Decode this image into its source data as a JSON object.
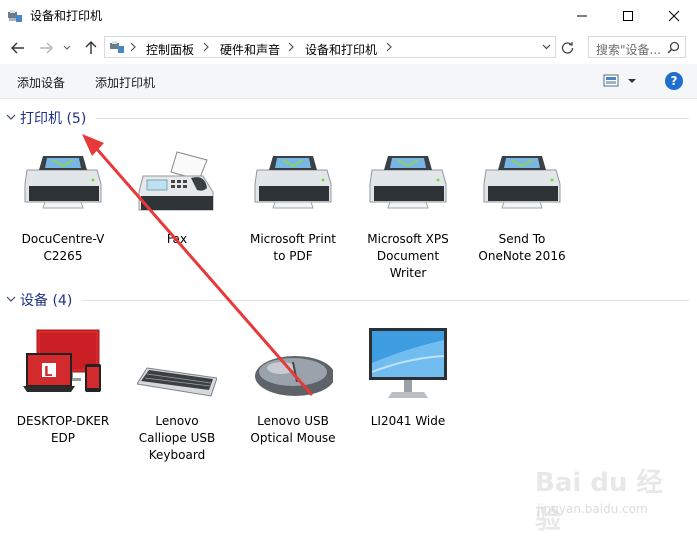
{
  "window": {
    "title": "设备和打印机"
  },
  "nav": {
    "back": "back",
    "forward": "forward",
    "recent": "recent",
    "up": "up"
  },
  "breadcrumb": [
    "控制面板",
    "硬件和声音",
    "设备和打印机"
  ],
  "search": {
    "placeholder": "搜索\"设备..."
  },
  "toolbar": {
    "add_device": "添加设备",
    "add_printer": "添加打印机"
  },
  "groups": {
    "printers": {
      "title": "打印机 (5)",
      "items": [
        {
          "label": "DocuCentre-V\nC2265",
          "icon": "printer-icon"
        },
        {
          "label": "Fax",
          "icon": "fax-icon"
        },
        {
          "label": "Microsoft Print\nto PDF",
          "icon": "printer-icon"
        },
        {
          "label": "Microsoft XPS\nDocument\nWriter",
          "icon": "printer-icon"
        },
        {
          "label": "Send To\nOneNote 2016",
          "icon": "printer-icon"
        }
      ]
    },
    "devices": {
      "title": "设备 (4)",
      "items": [
        {
          "label": "DESKTOP-DKER\nEDP",
          "icon": "computer-icon"
        },
        {
          "label": "Lenovo\nCalliope USB\nKeyboard",
          "icon": "keyboard-icon"
        },
        {
          "label": "Lenovo USB\nOptical Mouse",
          "icon": "mouse-icon"
        },
        {
          "label": "LI2041 Wide",
          "icon": "monitor-icon"
        }
      ]
    }
  },
  "watermark": {
    "brand": "Bai du 经验",
    "url": "jingyan.baidu.com"
  },
  "colors": {
    "group_title": "#1e3287",
    "annotation_arrow": "#e8393a",
    "help": "#1f6fd1"
  }
}
